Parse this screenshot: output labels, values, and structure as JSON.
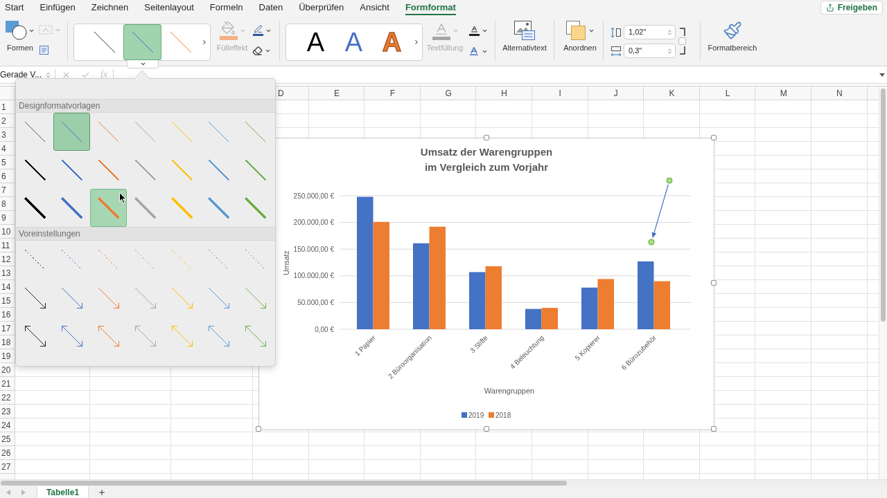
{
  "menu_tabs": [
    {
      "label": "Start",
      "selected": false
    },
    {
      "label": "Einfügen",
      "selected": false
    },
    {
      "label": "Zeichnen",
      "selected": false
    },
    {
      "label": "Seitenlayout",
      "selected": false
    },
    {
      "label": "Formeln",
      "selected": false
    },
    {
      "label": "Daten",
      "selected": false
    },
    {
      "label": "Überprüfen",
      "selected": false
    },
    {
      "label": "Ansicht",
      "selected": false
    },
    {
      "label": "Formformat",
      "selected": true
    }
  ],
  "share_button": {
    "label": "Freigeben"
  },
  "ribbon": {
    "shapes": {
      "label": "Formen"
    },
    "edit_shape": {
      "disabled": true
    },
    "shape_styles": [
      {
        "color": "#404040",
        "selected": false
      },
      {
        "color": "#4472c4",
        "selected": true
      },
      {
        "color": "#ed7d31",
        "selected": false
      }
    ],
    "shape_fill": {
      "label": "Fülleffekt",
      "disabled": true
    },
    "wordart_styles": [
      {
        "label": "A",
        "kind": "solid",
        "color": "#000000"
      },
      {
        "label": "A",
        "kind": "solid",
        "color": "#4472c4"
      },
      {
        "label": "A",
        "kind": "outline",
        "color": "#ed7d31"
      }
    ],
    "text_fill": {
      "label": "Textfüllung",
      "disabled": true
    },
    "alt_text": {
      "label": "Alternativtext"
    },
    "arrange": {
      "label": "Anordnen"
    },
    "size": {
      "height": "1,02\"",
      "width": "0,3\"",
      "lock_aspect": false
    },
    "format_pane": {
      "label": "Formatbereich"
    }
  },
  "formula_bar": {
    "name_box": "Gerade V...",
    "function_label": "fx",
    "buttons_disabled": true
  },
  "line_style_gallery": {
    "sections": [
      {
        "title": "Designformatvorlagen",
        "rows": [
          {
            "kind": "thin",
            "items": [
              {
                "color": "#595959",
                "selected": false,
                "hovered": false
              },
              {
                "color": "#4472c4",
                "selected": true,
                "hovered": false
              },
              {
                "color": "#ed7d31",
                "selected": false,
                "hovered": false
              },
              {
                "color": "#a5a5a5",
                "selected": false,
                "hovered": false
              },
              {
                "color": "#ffc000",
                "selected": false,
                "hovered": false
              },
              {
                "color": "#5b9bd5",
                "selected": false,
                "hovered": false
              },
              {
                "color": "#70ad47",
                "selected": false,
                "hovered": false
              }
            ]
          },
          {
            "kind": "medium",
            "items": [
              {
                "color": "#000000",
                "selected": false,
                "hovered": false
              },
              {
                "color": "#4472c4",
                "selected": false,
                "hovered": false
              },
              {
                "color": "#ed7d31",
                "selected": false,
                "hovered": false
              },
              {
                "color": "#a5a5a5",
                "selected": false,
                "hovered": false
              },
              {
                "color": "#ffc000",
                "selected": false,
                "hovered": false
              },
              {
                "color": "#5b9bd5",
                "selected": false,
                "hovered": false
              },
              {
                "color": "#70ad47",
                "selected": false,
                "hovered": false
              }
            ]
          },
          {
            "kind": "thick",
            "items": [
              {
                "color": "#000000",
                "selected": false,
                "hovered": false
              },
              {
                "color": "#4472c4",
                "selected": false,
                "hovered": false
              },
              {
                "color": "#ed7d31",
                "selected": false,
                "hovered": true
              },
              {
                "color": "#a5a5a5",
                "selected": false,
                "hovered": false
              },
              {
                "color": "#ffc000",
                "selected": false,
                "hovered": false
              },
              {
                "color": "#5b9bd5",
                "selected": false,
                "hovered": false
              },
              {
                "color": "#70ad47",
                "selected": false,
                "hovered": false
              }
            ]
          }
        ]
      },
      {
        "title": "Voreinstellungen",
        "rows": [
          {
            "kind": "dashed",
            "items": [
              {
                "color": "#262626",
                "selected": false,
                "hovered": false
              },
              {
                "color": "#4472c4",
                "selected": false,
                "hovered": false
              },
              {
                "color": "#ed7d31",
                "selected": false,
                "hovered": false
              },
              {
                "color": "#a5a5a5",
                "selected": false,
                "hovered": false
              },
              {
                "color": "#ffc000",
                "selected": false,
                "hovered": false
              },
              {
                "color": "#5b9bd5",
                "selected": false,
                "hovered": false
              },
              {
                "color": "#70ad47",
                "selected": false,
                "hovered": false
              }
            ]
          },
          {
            "kind": "arrow",
            "items": [
              {
                "color": "#262626",
                "selected": false,
                "hovered": false
              },
              {
                "color": "#4472c4",
                "selected": false,
                "hovered": false
              },
              {
                "color": "#ed7d31",
                "selected": false,
                "hovered": false
              },
              {
                "color": "#a5a5a5",
                "selected": false,
                "hovered": false
              },
              {
                "color": "#ffc000",
                "selected": false,
                "hovered": false
              },
              {
                "color": "#5b9bd5",
                "selected": false,
                "hovered": false
              },
              {
                "color": "#70ad47",
                "selected": false,
                "hovered": false
              }
            ]
          },
          {
            "kind": "double-arrow",
            "items": [
              {
                "color": "#262626",
                "selected": false,
                "hovered": false
              },
              {
                "color": "#4472c4",
                "selected": false,
                "hovered": false
              },
              {
                "color": "#ed7d31",
                "selected": false,
                "hovered": false
              },
              {
                "color": "#a5a5a5",
                "selected": false,
                "hovered": false
              },
              {
                "color": "#ffc000",
                "selected": false,
                "hovered": false
              },
              {
                "color": "#5b9bd5",
                "selected": false,
                "hovered": false
              },
              {
                "color": "#70ad47",
                "selected": false,
                "hovered": false
              }
            ]
          }
        ]
      }
    ]
  },
  "sheet": {
    "columns": [
      "D",
      "E",
      "F",
      "G",
      "H",
      "I",
      "J",
      "K",
      "L",
      "M",
      "N"
    ],
    "rows": [
      "1",
      "2",
      "3",
      "4",
      "5",
      "6",
      "7",
      "8",
      "9",
      "10",
      "11",
      "12",
      "13",
      "14",
      "15",
      "16",
      "17",
      "18",
      "19",
      "20",
      "21",
      "22",
      "23",
      "24",
      "25",
      "26",
      "27"
    ],
    "tabs": [
      {
        "label": "Tabelle1",
        "selected": true
      }
    ]
  },
  "chart": {
    "selected": true,
    "arrow_shape": {
      "selected": true
    },
    "chart_data": {
      "type": "bar",
      "title": "Umsatz der Warengruppen\nim Vergleich zum Vorjahr",
      "xlabel": "Warengruppen",
      "ylabel": "Umsatz",
      "categories": [
        "1 Papier",
        "2 Büroorganisation",
        "3 Stifte",
        "4 Beleuchtung",
        "5 Kopierer",
        "6 Bürozubehör"
      ],
      "series": [
        {
          "name": "2019",
          "color": "#4472c4",
          "values": [
            248000,
            161000,
            107000,
            38000,
            78000,
            127000
          ]
        },
        {
          "name": "2018",
          "color": "#ed7d31",
          "values": [
            201000,
            192000,
            118000,
            40000,
            94000,
            90000
          ]
        }
      ],
      "ylim": [
        0,
        250000
      ],
      "yticks": [
        {
          "value": 0,
          "label": "0,00 €"
        },
        {
          "value": 50000,
          "label": "50.000,00 €"
        },
        {
          "value": 100000,
          "label": "100.000,00 €"
        },
        {
          "value": 150000,
          "label": "150.000,00 €"
        },
        {
          "value": 200000,
          "label": "200.000,00 €"
        },
        {
          "value": 250000,
          "label": "250.000,00 €"
        }
      ],
      "grid": true,
      "legend": "lower center"
    }
  }
}
